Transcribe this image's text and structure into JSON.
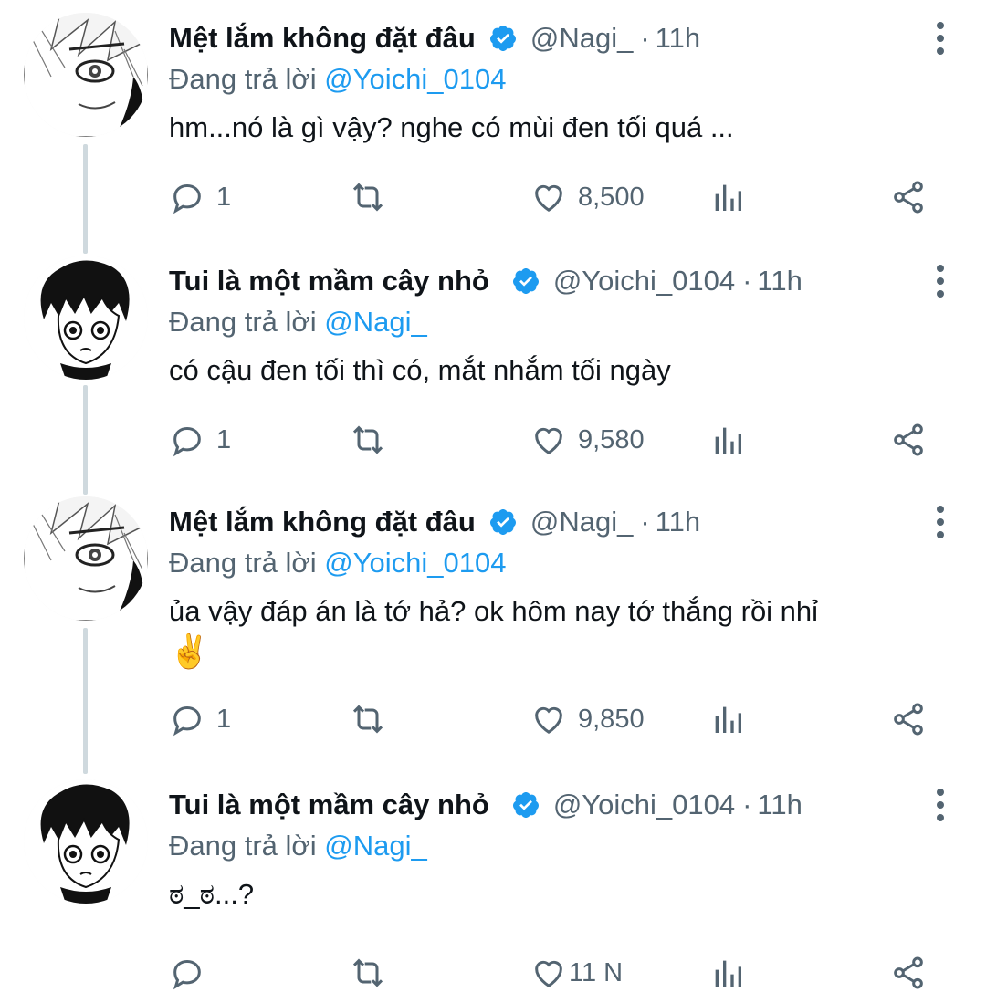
{
  "tweets": [
    {
      "author_name": "Mệt lắm không đặt đâu",
      "handle": "@Nagi_",
      "time": "11h",
      "replying_prefix": "Đang trả lời",
      "replying_to": "@Yoichi_0104",
      "text_lines": [
        "hm...nó là gì vậy? nghe có mùi đen tối quá ..."
      ],
      "emoji": "",
      "replies": "1",
      "likes": "8,500",
      "avatar": "white-haired-manga-avatar"
    },
    {
      "author_name": "Tui là một mầm cây nhỏ",
      "handle": "@Yoichi_0104",
      "time": "11h",
      "replying_prefix": "Đang trả lời",
      "replying_to": "@Nagi_",
      "text_lines": [
        "có cậu đen tối thì có, mắt nhắm tối ngày"
      ],
      "emoji": "",
      "replies": "1",
      "likes": "9,580",
      "avatar": "black-haired-manga-avatar"
    },
    {
      "author_name": "Mệt lắm không đặt đâu",
      "handle": "@Nagi_",
      "time": "11h",
      "replying_prefix": "Đang trả lời",
      "replying_to": "@Yoichi_0104",
      "text_lines": [
        "ủa vậy đáp án là tớ hả? ok hôm nay tớ thắng rồi nhỉ"
      ],
      "emoji": "✌️",
      "replies": "1",
      "likes": "9,850",
      "avatar": "white-haired-manga-avatar"
    },
    {
      "author_name": "Tui là một mầm cây nhỏ",
      "handle": "@Yoichi_0104",
      "time": "11h",
      "replying_prefix": "Đang trả lời",
      "replying_to": "@Nagi_",
      "text_lines": [
        "ಠ_ಠ...?"
      ],
      "emoji": "",
      "replies": "",
      "likes": "11 N",
      "avatar": "black-haired-manga-avatar"
    }
  ],
  "colors": {
    "accent": "#1d9bf0",
    "secondary_text": "#536471",
    "primary_text": "#0f1419",
    "thread_line": "#cfd9de"
  },
  "icons": {
    "reply": "reply-icon",
    "retweet": "retweet-icon",
    "like": "heart-icon",
    "views": "analytics-icon",
    "share": "share-icon",
    "verified": "verified-badge-icon",
    "more": "more-options-icon"
  }
}
